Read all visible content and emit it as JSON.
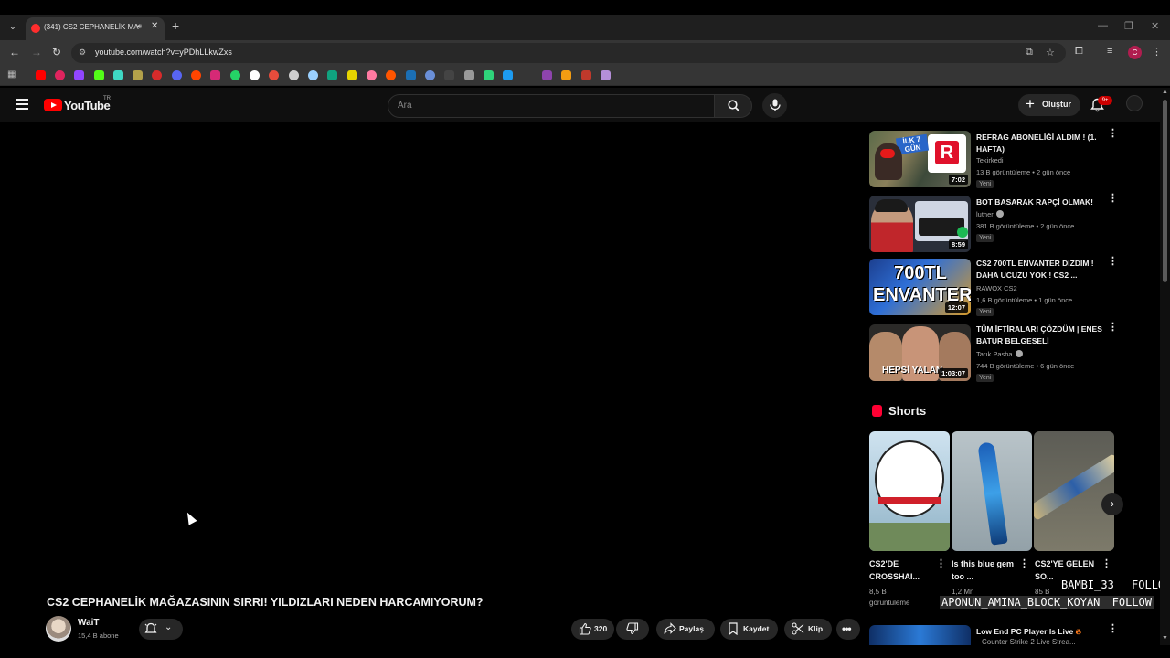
{
  "browser": {
    "tab_title": "(341) CS2 CEPHANELİK MAĞ",
    "url": "youtube.com/watch?v=yPDhLLkwZxs",
    "profile_initial": "C",
    "tab_list_icon": "chevron-down-icon"
  },
  "youtube": {
    "logo_text": "YouTube",
    "country_code": "TR",
    "search_placeholder": "Ara",
    "create_label": "Oluştur",
    "notif_count": "9+"
  },
  "video": {
    "title": "CS2 CEPHANELİK MAĞAZASININ SIRRI! YILDIZLARI NEDEN HARCAMIYORUM?",
    "channel": "WaiT",
    "subscribers": "15,4 B abone",
    "likes": "320",
    "share_label": "Paylaş",
    "save_label": "Kaydet",
    "clip_label": "Klip"
  },
  "recommendations": [
    {
      "title": "REFRAG ABONELİĞİ ALDIM ! (1. HAFTA)",
      "channel": "Tekirkedi",
      "verified": false,
      "meta": "13 B görüntüleme • 2 gün önce",
      "badge": "Yeni",
      "duration": "7:02",
      "thumb_text": "İLK 7 GÜN"
    },
    {
      "title": "BOT BASARAK RAPÇİ OLMAK!",
      "channel": "luther",
      "verified": true,
      "meta": "381 B görüntüleme • 2 gün önce",
      "badge": "Yeni",
      "duration": "8:59"
    },
    {
      "title": "CS2 700TL ENVANTER DİZDİM ! DAHA UCUZU YOK ! CS2 ...",
      "channel": "RAWOX CS2",
      "verified": false,
      "meta": "1,6 B görüntüleme • 1 gün önce",
      "badge": "Yeni",
      "duration": "12:07",
      "thumb_text": "700TL ENVANTER"
    },
    {
      "title": "TÜM İFTİRALARI ÇÖZDÜM | ENES BATUR BELGESELİ",
      "channel": "Tarık Pasha",
      "verified": true,
      "meta": "744 B görüntüleme • 6 gün önce",
      "badge": "Yeni",
      "duration": "1:03:07",
      "thumb_text": "HEPSİ YALAN"
    }
  ],
  "shorts": {
    "header": "Shorts",
    "items": [
      {
        "title": "CS2'DE CROSSHAI...",
        "views_line1": "8,5 B",
        "views_line2": "görüntüleme"
      },
      {
        "title": "Is this blue gem too ...",
        "views_line1": "1,2 Mn",
        "views_line2": ""
      },
      {
        "title": "CS2'YE GELEN SO...",
        "views_line1": "85 B",
        "views_line2": ""
      }
    ]
  },
  "next_rec": {
    "title": "Low End PC Player Is Live",
    "channel_line": "Counter Strike 2 Live Strea..."
  },
  "stream_overlay": {
    "line1_name": "BAMBI_33",
    "line1_action": "FOLLOW",
    "line2_name": "APONUN_AMINA_BLOCK_KOYAN",
    "line2_action": "FOLLOW"
  }
}
